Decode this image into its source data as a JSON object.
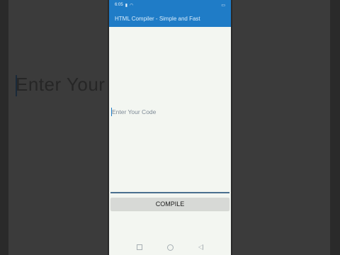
{
  "status_bar": {
    "time": "6:05",
    "left_icons": [
      "signal-icon",
      "wifi-icon"
    ],
    "right_icons": [
      "battery-icon"
    ]
  },
  "app_bar": {
    "title": "HTML Compiler - Simple and Fast"
  },
  "editor": {
    "placeholder": "Enter Your Code",
    "value": ""
  },
  "compile_button": {
    "label": "COMPILE"
  },
  "background": {
    "blurred_text": "Enter Your C"
  },
  "colors": {
    "app_bar": "#1f7cc7",
    "screen_bg": "#f3f6f1",
    "button_bg": "#d7d9d6"
  }
}
